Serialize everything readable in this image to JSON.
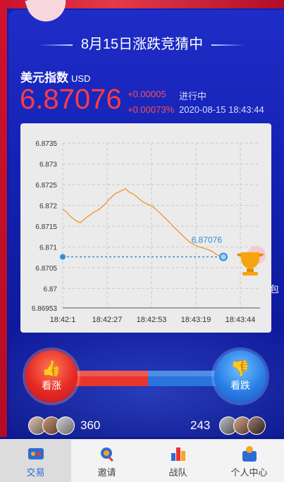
{
  "header": {
    "title": "8月15日涨跌竞猜中"
  },
  "index": {
    "name": "美元指数",
    "unit": "USD",
    "price": "6.87076",
    "change": "+0.00005",
    "change_pct": "+0.00073%",
    "status": "进行中",
    "timestamp": "2020-08-15 18:43:44"
  },
  "chart_data": {
    "type": "line",
    "x_ticks": [
      "18:42:1",
      "18:42:27",
      "18:42:53",
      "18:43:19",
      "18:43:44"
    ],
    "y_ticks": [
      "6.8735",
      "6.873",
      "6.8725",
      "6.872",
      "6.8715",
      "6.871",
      "6.8705",
      "6.87",
      "6.86953"
    ],
    "ylim": [
      6.86953,
      6.8735
    ],
    "reference_value": 6.87076,
    "last_label": "6.87076",
    "grid": true,
    "series": [
      {
        "values": [
          6.8719,
          6.87185,
          6.87175,
          6.87168,
          6.87162,
          6.87158,
          6.87165,
          6.87172,
          6.87178,
          6.87184,
          6.87188,
          6.87194,
          6.87202,
          6.87212,
          6.8722,
          6.87228,
          6.87232,
          6.87236,
          6.8724,
          6.87232,
          6.87228,
          6.87222,
          6.87215,
          6.87208,
          6.87204,
          6.872,
          6.87196,
          6.87188,
          6.8718,
          6.87172,
          6.87164,
          6.87155,
          6.87146,
          6.87138,
          6.8713,
          6.87122,
          6.87114,
          6.87108,
          6.87104,
          6.871,
          6.87098,
          6.87095,
          6.87092,
          6.87088,
          6.87082,
          6.87078,
          6.87076
        ]
      }
    ]
  },
  "trophy_label": "包",
  "vote": {
    "up_label": "看涨",
    "down_label": "看跌",
    "up_count": "360",
    "down_count": "243"
  },
  "tabs": [
    {
      "label": "交易",
      "icon": "trade-icon"
    },
    {
      "label": "邀请",
      "icon": "invite-icon"
    },
    {
      "label": "战队",
      "icon": "team-icon"
    },
    {
      "label": "个人中心",
      "icon": "profile-icon"
    }
  ],
  "colors": {
    "up": "#e8362e",
    "down": "#2a74df",
    "line": "#f08c1e",
    "ref": "#2f8fd6",
    "active_tab": "#2b6cd6"
  }
}
